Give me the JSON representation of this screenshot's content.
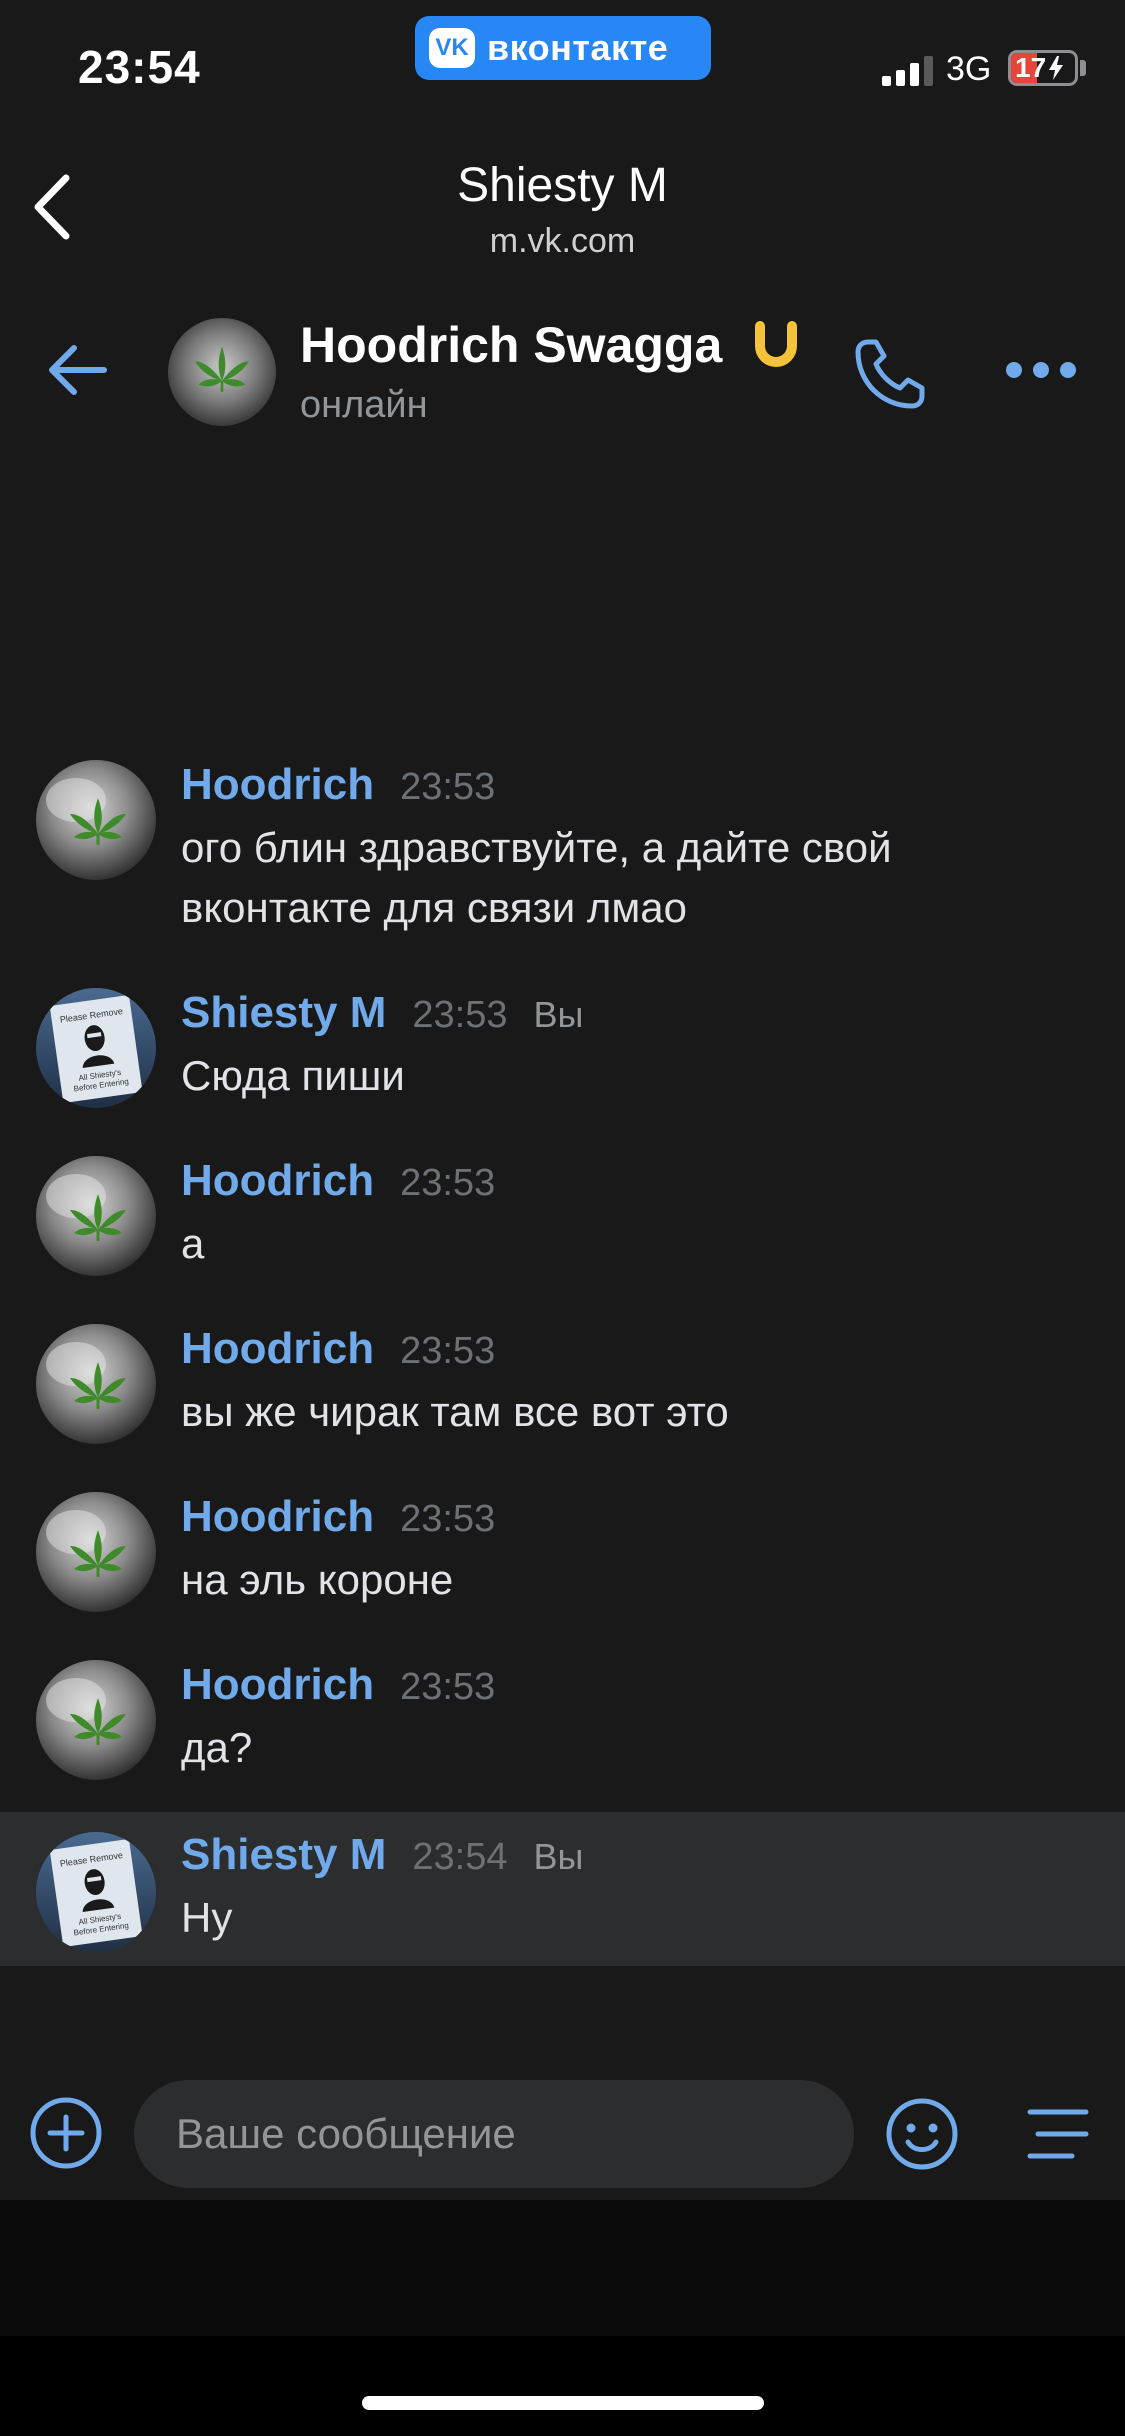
{
  "status_bar": {
    "time": "23:54",
    "app_pill": "вконтакте",
    "app_logo": "VK",
    "network": "3G",
    "battery": "17"
  },
  "browser": {
    "title": "Shiesty M",
    "url": "m.vk.com"
  },
  "chat_header": {
    "name": "Hoodrich Swagga",
    "status": "онлайн",
    "badge_icon": "horseshoe-icon"
  },
  "messages": [
    {
      "author": "Hoodrich",
      "time": "23:53",
      "own": false,
      "text_lines": [
        "ого блин здравствуйте, а дайте свой",
        "вконтакте для связи лмао"
      ]
    },
    {
      "author": "Shiesty M",
      "time": "23:53",
      "own": true,
      "you_label": "Вы",
      "text_lines": [
        "Сюда пиши"
      ]
    },
    {
      "author": "Hoodrich",
      "time": "23:53",
      "own": false,
      "text_lines": [
        "а"
      ]
    },
    {
      "author": "Hoodrich",
      "time": "23:53",
      "own": false,
      "text_lines": [
        "вы же чирак там все вот это"
      ]
    },
    {
      "author": "Hoodrich",
      "time": "23:53",
      "own": false,
      "text_lines": [
        "на эль короне"
      ]
    },
    {
      "author": "Hoodrich",
      "time": "23:53",
      "own": false,
      "text_lines": [
        "да?"
      ]
    },
    {
      "author": "Shiesty M",
      "time": "23:54",
      "own": true,
      "you_label": "Вы",
      "text_lines": [
        "Ну"
      ]
    }
  ],
  "avatar_sign_text": [
    "Please Remove",
    "All Shiesty's",
    "Before Entering"
  ],
  "composer": {
    "placeholder": "Ваше сообщение"
  },
  "colors": {
    "accent": "#71aaeb",
    "background": "#19191a",
    "highlight_row": "#2c2d2f",
    "vk_blue": "#2787f5"
  }
}
